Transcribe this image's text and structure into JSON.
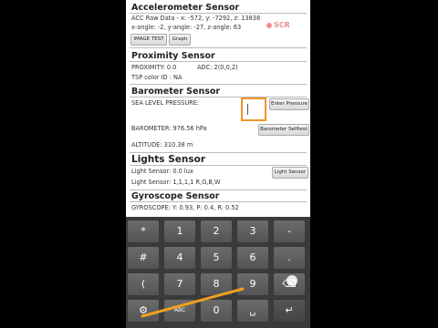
{
  "accelerometer": {
    "title": "Accelerometer Sensor",
    "raw_line": "ACC Raw Data - x: -572, y: -7292, z: 13838",
    "angle_line": "x-angle: -2, y-angle: -27, z-angle: 63",
    "image_test_label": "IMAGE TEST",
    "graph_label": "Graph"
  },
  "recorder": {
    "label": "SCR"
  },
  "proximity": {
    "title": "Proximity Sensor",
    "line1": "PROXIMITY: 0.0",
    "adc": "ADC: 2(0,0,2)",
    "line2": "TSP color ID : NA"
  },
  "barometer": {
    "title": "Barometer Sensor",
    "sea_level_label": "SEA LEVEL PRESSURE:",
    "sea_level_value": "",
    "enter_pressure_label": "Enter Pressure",
    "reading": "BAROMETER: 976.56 hPa",
    "selftest_label": "Barometer Selftest",
    "altitude": "ALTITUDE: 310.38 m"
  },
  "lights": {
    "title": "Lights Sensor",
    "line1": "Light Sensor: 0.0 lux",
    "line2": "Light Sensor: 1,1,1,1 R,G,B,W",
    "button_label": "Light Sensor"
  },
  "gyroscope": {
    "title": "Gyroscope Sensor",
    "reading": "GYROSCOPE: Y: 0.93, P: 0.4, R: 0.52"
  },
  "keyboard": {
    "row1": [
      "*",
      "1",
      "2",
      "3",
      "-"
    ],
    "row2": [
      "#",
      "4",
      "5",
      "6",
      "."
    ],
    "row3": [
      "(",
      "7",
      "8",
      "9",
      "⌫"
    ],
    "row4": [
      "",
      "ABC",
      "0",
      "␣",
      "↵"
    ]
  }
}
